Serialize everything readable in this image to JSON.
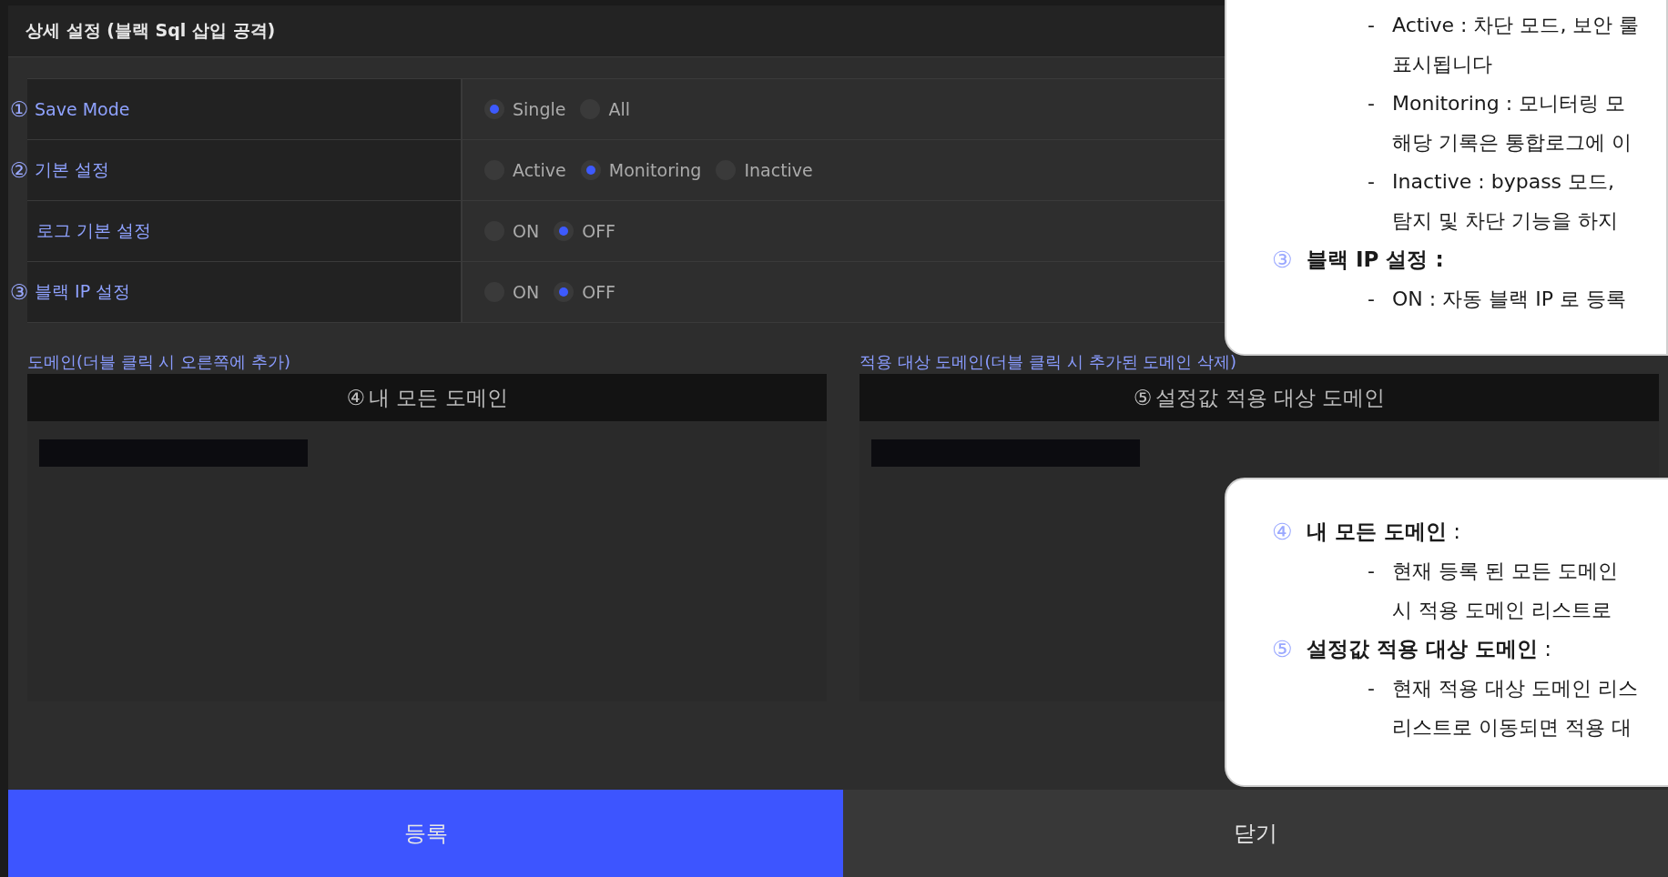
{
  "dialog": {
    "title": "상세 설정 (블랙 Sql 삽입 공격)"
  },
  "settings": [
    {
      "marker": "①",
      "label": "Save Mode",
      "options": [
        {
          "label": "Single",
          "selected": true
        },
        {
          "label": "All",
          "selected": false
        }
      ]
    },
    {
      "marker": "②",
      "label": "기본 설정",
      "options": [
        {
          "label": "Active",
          "selected": false
        },
        {
          "label": "Monitoring",
          "selected": true
        },
        {
          "label": "Inactive",
          "selected": false
        }
      ]
    },
    {
      "label": "로그 기본 설정",
      "options": [
        {
          "label": "ON",
          "selected": false
        },
        {
          "label": "OFF",
          "selected": true
        }
      ]
    },
    {
      "marker": "③",
      "label": "블랙 IP 설정",
      "options": [
        {
          "label": "ON",
          "selected": false
        },
        {
          "label": "OFF",
          "selected": true
        }
      ]
    }
  ],
  "domain_lists": [
    {
      "caption": "도메인(더블 클릭 시 오른쪽에 추가)",
      "marker": "④",
      "header": "내 모든 도메인",
      "entries": [
        {
          "kind": "redacted"
        }
      ]
    },
    {
      "caption": "적용 대상 도메인(더블 클릭 시 추가된 도메인 삭제)",
      "marker": "⑤",
      "header": "설정값 적용 대상 도메인",
      "entries": [
        {
          "kind": "redacted"
        }
      ]
    }
  ],
  "buttons": [
    {
      "label": "등록",
      "kind": "primary"
    },
    {
      "label": "닫기",
      "kind": "secondary"
    }
  ],
  "help_callouts": [
    {
      "items": [
        {
          "kind": "bullet",
          "bullet": "-",
          "text": "Active : 차단 모드, 보안 룰"
        },
        {
          "kind": "continuation",
          "text": "표시됩니다"
        },
        {
          "kind": "bullet",
          "bullet": "-",
          "text": "Monitoring : 모니터링 모"
        },
        {
          "kind": "continuation",
          "text": "해당 기록은 통합로그에 이"
        },
        {
          "kind": "bullet",
          "bullet": "-",
          "text": "Inactive : bypass 모드,"
        },
        {
          "kind": "continuation",
          "text": "탐지 및 차단 기능을 하지"
        },
        {
          "kind": "heading",
          "marker": "③",
          "text": "블랙 IP 설정 :"
        },
        {
          "kind": "bullet",
          "bullet": "-",
          "text": "ON : 자동 블랙 IP 로 등록"
        }
      ]
    },
    {
      "items": [
        {
          "kind": "heading_mixed",
          "marker": "④",
          "text": "**내 모든 도메인** :"
        },
        {
          "kind": "bullet",
          "bullet": "-",
          "text": "현재 등록 된 모든 도메인"
        },
        {
          "kind": "continuation",
          "text": "시 적용 도메인 리스트로"
        },
        {
          "kind": "heading_mixed",
          "marker": "⑤",
          "text": "**설정값 적용 대상 도메인** :"
        },
        {
          "kind": "bullet",
          "bullet": "-",
          "text": "현재 적용 대상 도메인 리스"
        },
        {
          "kind": "continuation",
          "text": "리스트로 이동되면 적용 대"
        }
      ]
    }
  ]
}
